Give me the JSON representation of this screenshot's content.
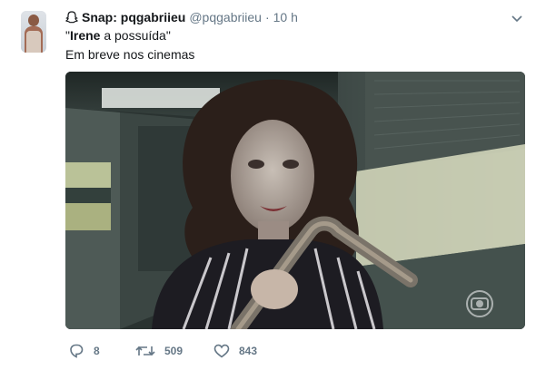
{
  "tweet": {
    "display_name": "Snap: pqgabriieu",
    "handle": "@pqgabriieu",
    "separator": "·",
    "time": "10 h",
    "line1": {
      "quote_open": "\"",
      "bold_name": "Irene",
      "rest": " a possuída\""
    },
    "line2": "Em breve nos cinemas",
    "media": {
      "watermark_icon": "globo-logo-icon",
      "description_icon": "video-still"
    },
    "actions": {
      "reply_count": "8",
      "retweet_count": "509",
      "like_count": "843"
    },
    "icons": {
      "reply": "reply-icon",
      "retweet": "retweet-icon",
      "like": "heart-icon",
      "menu": "chevron-down-icon",
      "snap": "ghost-icon"
    }
  }
}
